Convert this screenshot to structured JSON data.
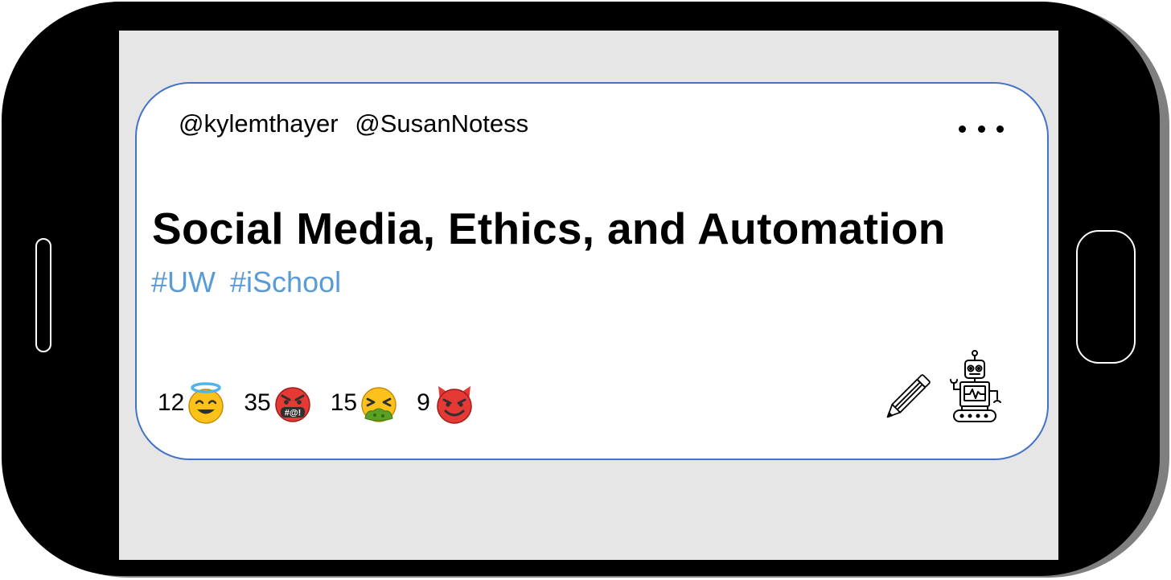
{
  "post": {
    "handles": [
      "@kylemthayer",
      "@SusanNotess"
    ],
    "title": "Social Media, Ethics, and Automation",
    "hashtags": [
      "#UW",
      "#iSchool"
    ],
    "reactions": [
      {
        "count": "12",
        "icon": "smiling-face-with-halo-icon"
      },
      {
        "count": "35",
        "icon": "face-with-symbols-on-mouth-icon"
      },
      {
        "count": "15",
        "icon": "nauseated-face-icon"
      },
      {
        "count": "9",
        "icon": "smiling-face-with-horns-icon"
      }
    ],
    "actions": {
      "more_icon": "more-options-icon",
      "edit_icon": "pencil-icon",
      "bot_icon": "robot-icon"
    }
  },
  "colors": {
    "card_border": "#4472c4",
    "hashtag": "#5b9bd5",
    "screen": "#e6e6e6",
    "phone": "#000000"
  }
}
